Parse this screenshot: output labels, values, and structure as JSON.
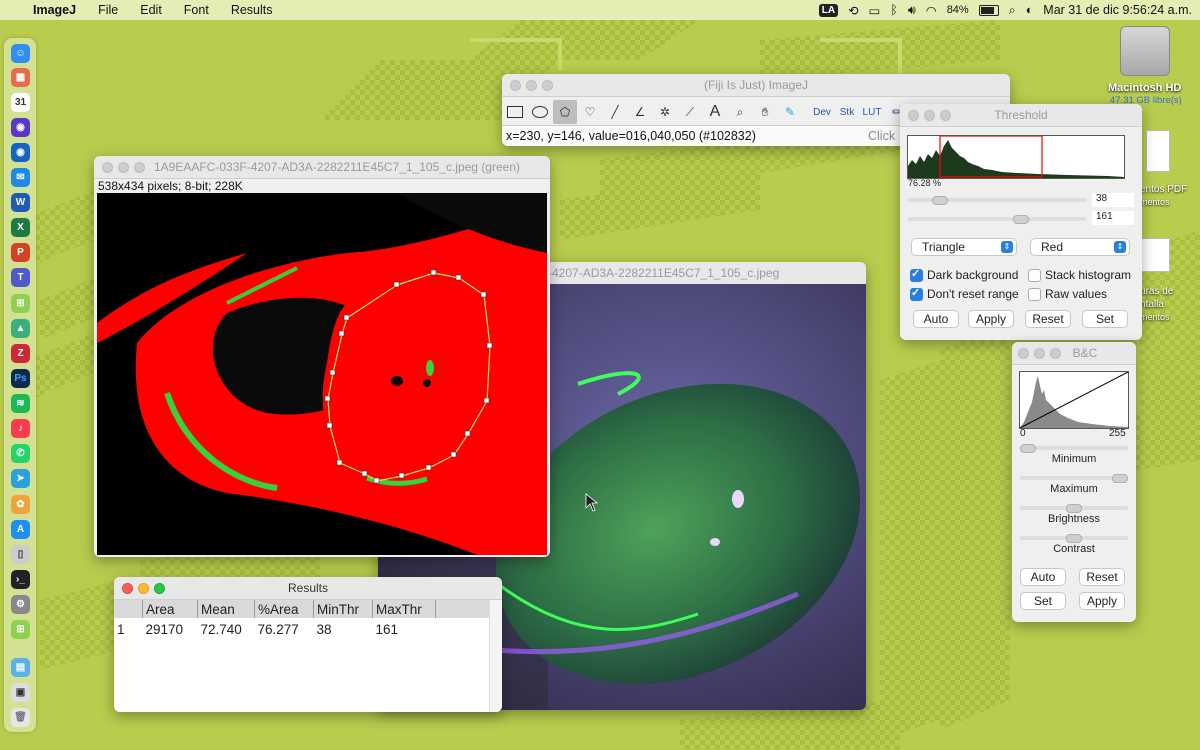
{
  "menubar": {
    "apple": "",
    "app_name": "ImageJ",
    "menus": [
      "File",
      "Edit",
      "Font",
      "Results"
    ],
    "input_source": "LA",
    "battery": "84%",
    "datetime": "Mar 31 de dic  9:56:24 a.m."
  },
  "desktop": {
    "drive_name": "Macintosh HD",
    "drive_info": "47.31 GB libre(s)",
    "file1_label": "entos PDF",
    "file1_sub": "mentos",
    "file2_label1": "uras de",
    "file2_label2": "ntalla",
    "file2_sub": "mentos"
  },
  "toolbar_win": {
    "title": "(Fiji Is Just) ImageJ",
    "status": "x=230, y=146, value=016,040,050 (#102832)",
    "click_hint": "Click",
    "tools": [
      "Dev",
      "Stk",
      "LUT"
    ]
  },
  "image_green": {
    "title": "1A9EAAFC-033F-4207-AD3A-2282211E45C7_1_105_c.jpeg (green)",
    "info": "538x434 pixels; 8-bit; 228K"
  },
  "image_color": {
    "title": "-4207-AD3A-2282211E45C7_1_105_c.jpeg"
  },
  "threshold": {
    "title": "Threshold",
    "percent": "76.28 %",
    "min_value": "38",
    "max_value": "161",
    "method": "Triangle",
    "mode": "Red",
    "dark_background": "Dark background",
    "stack_histogram": "Stack histogram",
    "dont_reset": "Don't reset range",
    "raw_values": "Raw values",
    "btn_auto": "Auto",
    "btn_apply": "Apply",
    "btn_reset": "Reset",
    "btn_set": "Set"
  },
  "bc": {
    "title": "B&C",
    "axis_min": "0",
    "axis_max": "255",
    "minimum": "Minimum",
    "maximum": "Maximum",
    "brightness": "Brightness",
    "contrast": "Contrast",
    "btn_auto": "Auto",
    "btn_reset": "Reset",
    "btn_set": "Set",
    "btn_apply": "Apply"
  },
  "results": {
    "title": "Results",
    "columns": [
      "",
      "Area",
      "Mean",
      "%Area",
      "MinThr",
      "MaxThr"
    ],
    "rows": [
      [
        "1",
        "29170",
        "72.740",
        "76.277",
        "38",
        "161"
      ]
    ]
  },
  "colors": {
    "desktop": "#b9cc4e",
    "threshold_red": "#ff0000",
    "overlay_green": "#37d13a"
  }
}
